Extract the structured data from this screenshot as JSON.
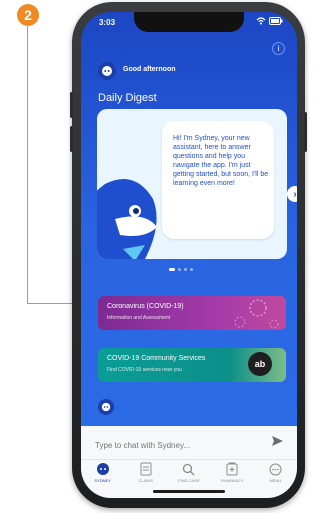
{
  "annotation": {
    "badge": "2"
  },
  "colors": {
    "accent": "#f08a24",
    "brand_blue": "#1f4fcf",
    "purple": "#8d2d9a",
    "teal": "#0d9e97"
  },
  "status_bar": {
    "time": "3:03",
    "icons": "wifi-icon battery-icon"
  },
  "greeting": {
    "text": "Good afternoon"
  },
  "digest": {
    "title": "Daily Digest"
  },
  "hero": {
    "message": "Hi! I'm Sydney, your new assistant, here to answer questions and help you navigate the app. I'm just getting started, but soon, I'll be learning even more!"
  },
  "pager": {
    "count": 4,
    "active_index": 0
  },
  "cards": [
    {
      "title": "Coronavirus (COVID-19)",
      "subtitle": "Information and Assessment"
    },
    {
      "title": "COVID-19 Community Services",
      "subtitle": "Find COVID-19 services near you",
      "logo": "ab"
    }
  ],
  "chat": {
    "placeholder": "Type to chat with Sydney...",
    "send_icon": "send-icon"
  },
  "nav": [
    {
      "label": "SYDNEY",
      "icon": "sydney-avatar-icon",
      "active": true
    },
    {
      "label": "CLAIMS",
      "icon": "claims-icon",
      "active": false
    },
    {
      "label": "FIND CARE",
      "icon": "find-care-icon",
      "active": false
    },
    {
      "label": "PHARMACY",
      "icon": "pharmacy-icon",
      "active": false
    },
    {
      "label": "MENU",
      "icon": "menu-icon",
      "active": false
    }
  ]
}
